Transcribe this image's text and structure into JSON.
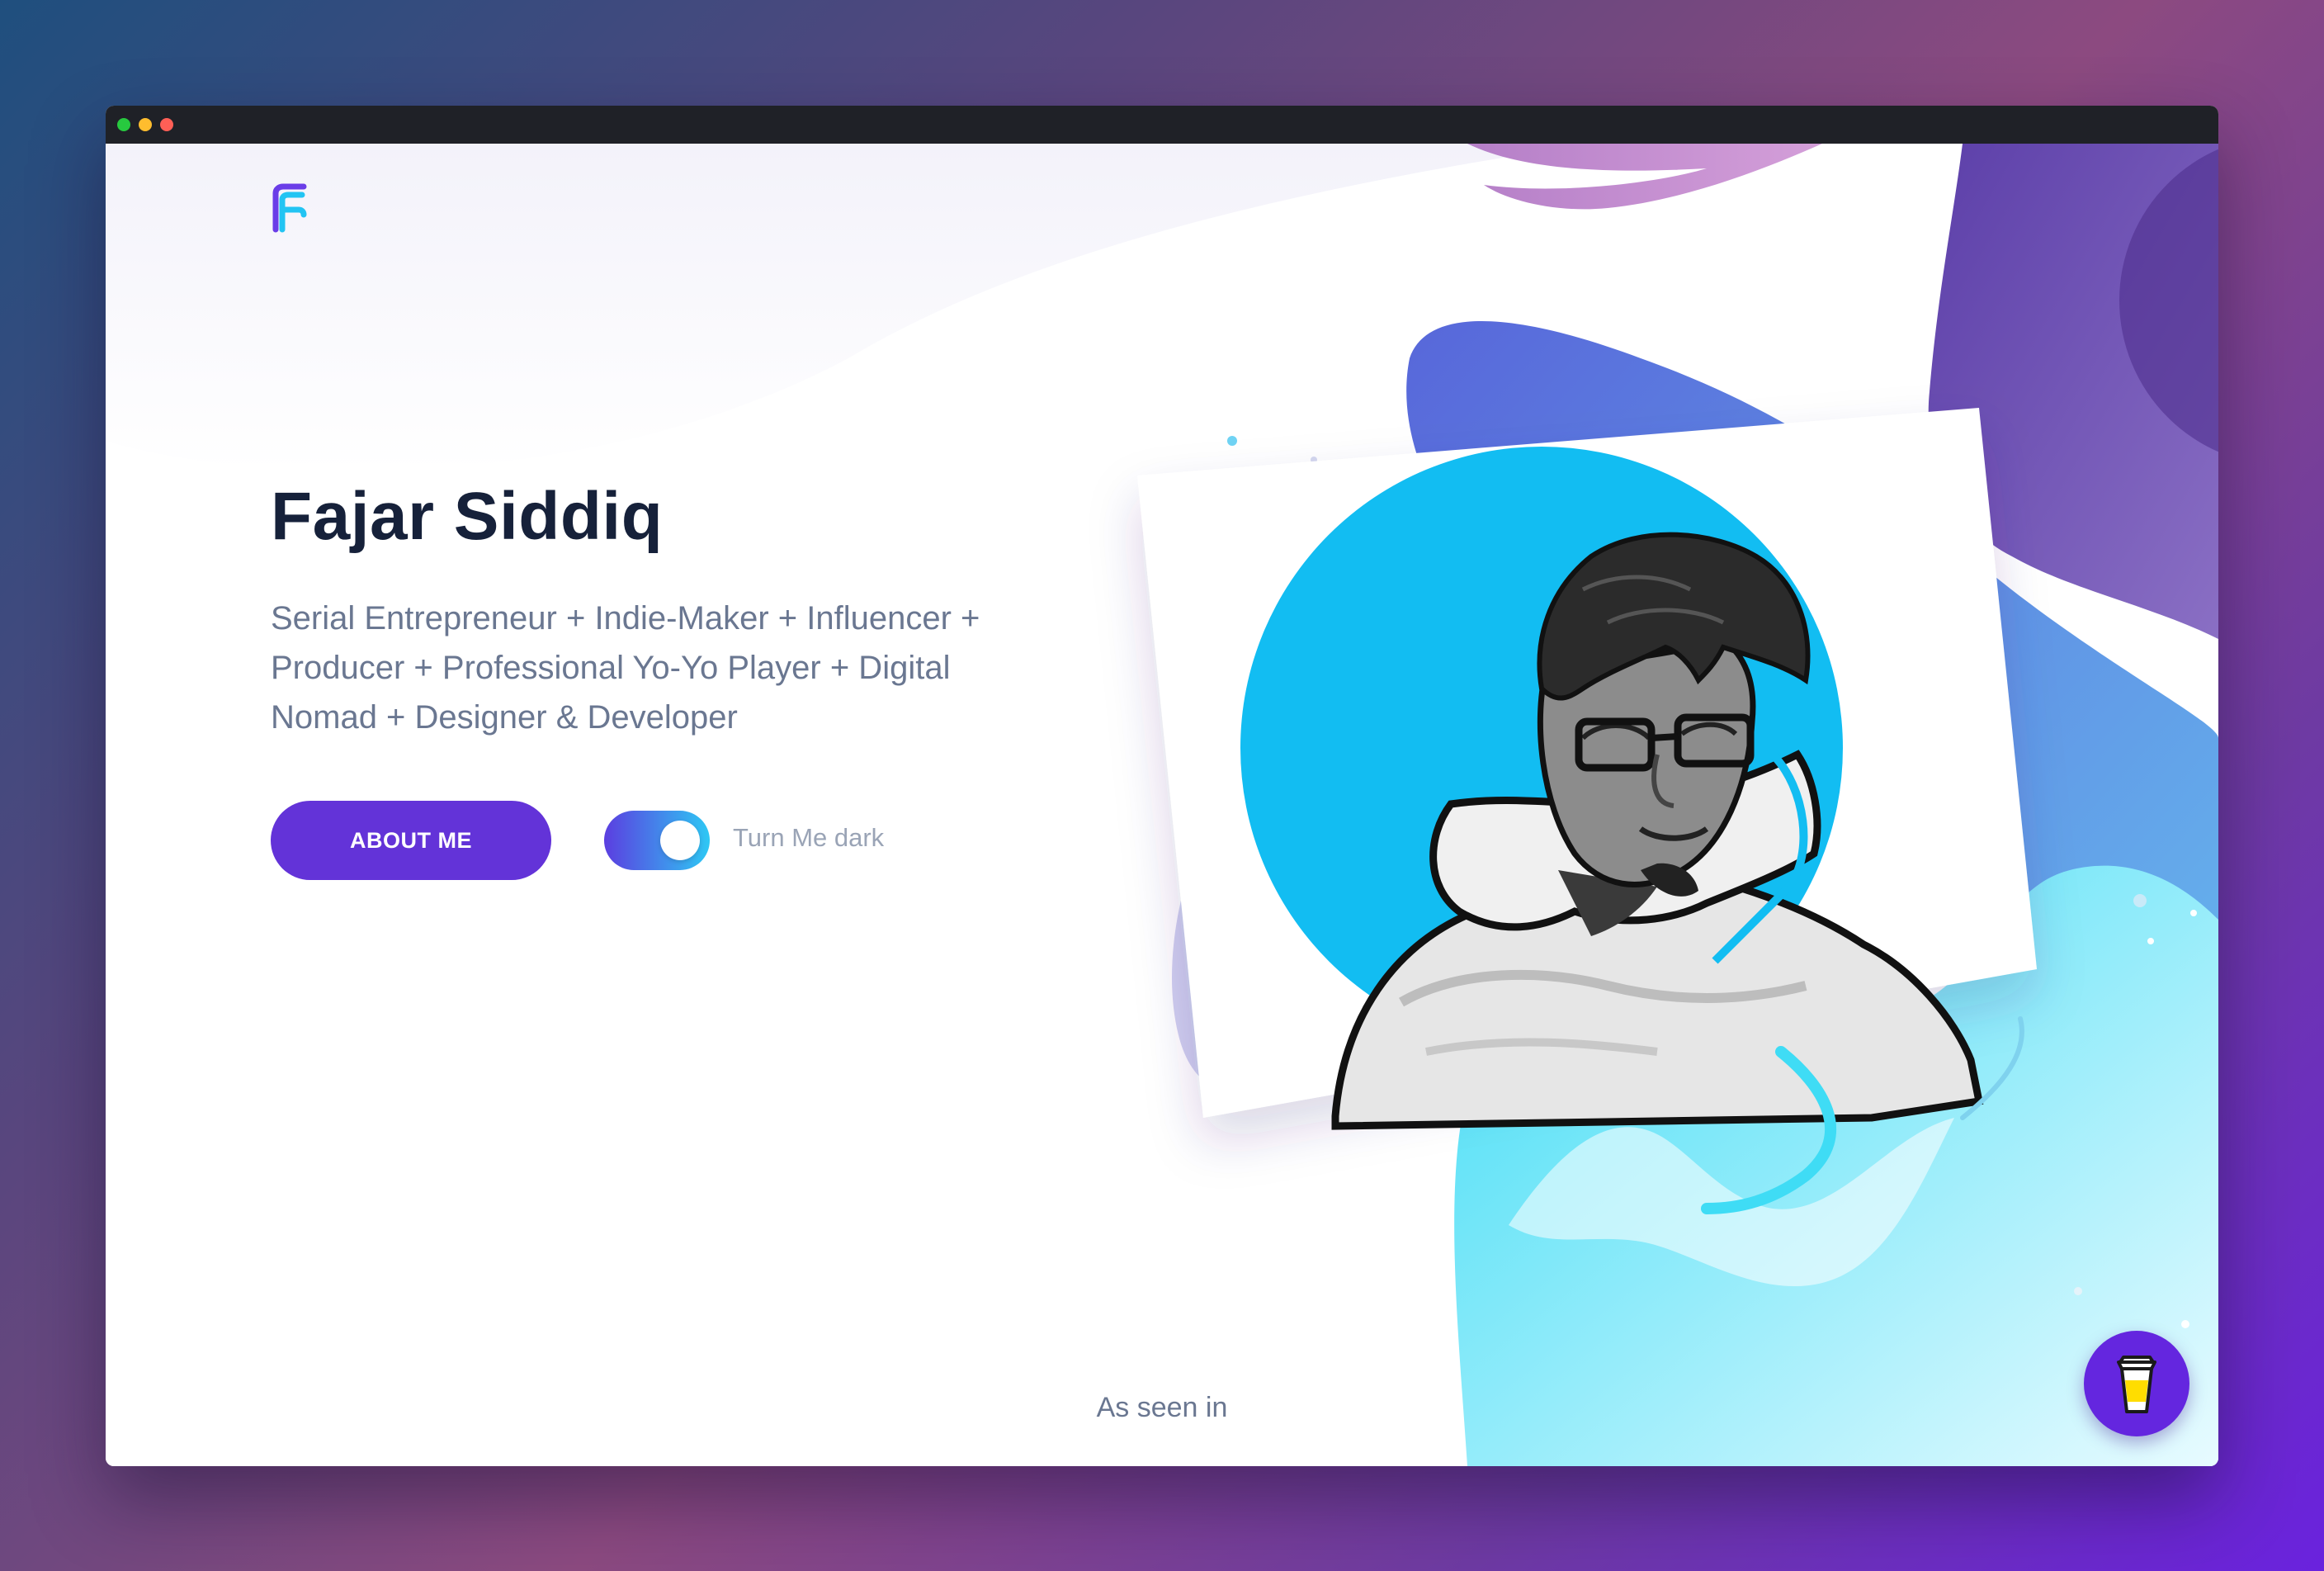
{
  "hero": {
    "name": "Fajar Siddiq",
    "tagline": "Serial Entrepreneur + Indie-Maker + Influencer + Producer + Professional Yo-Yo Player + Digital Nomad + Designer & Developer"
  },
  "actions": {
    "about_label": "ABOUT ME",
    "dark_mode_label": "Turn Me dark",
    "dark_mode_on": true
  },
  "footer": {
    "seen_in": "As seen in"
  },
  "icons": {
    "logo": "logo-f-icon",
    "coffee": "coffee-cup-icon"
  },
  "colors": {
    "accent": "#6333d8",
    "heading": "#16213a",
    "body_text": "#6a7791",
    "avatar_circle": "#12bdf2",
    "toggle_start": "#5b3ee0",
    "toggle_end": "#2ec8f4"
  }
}
